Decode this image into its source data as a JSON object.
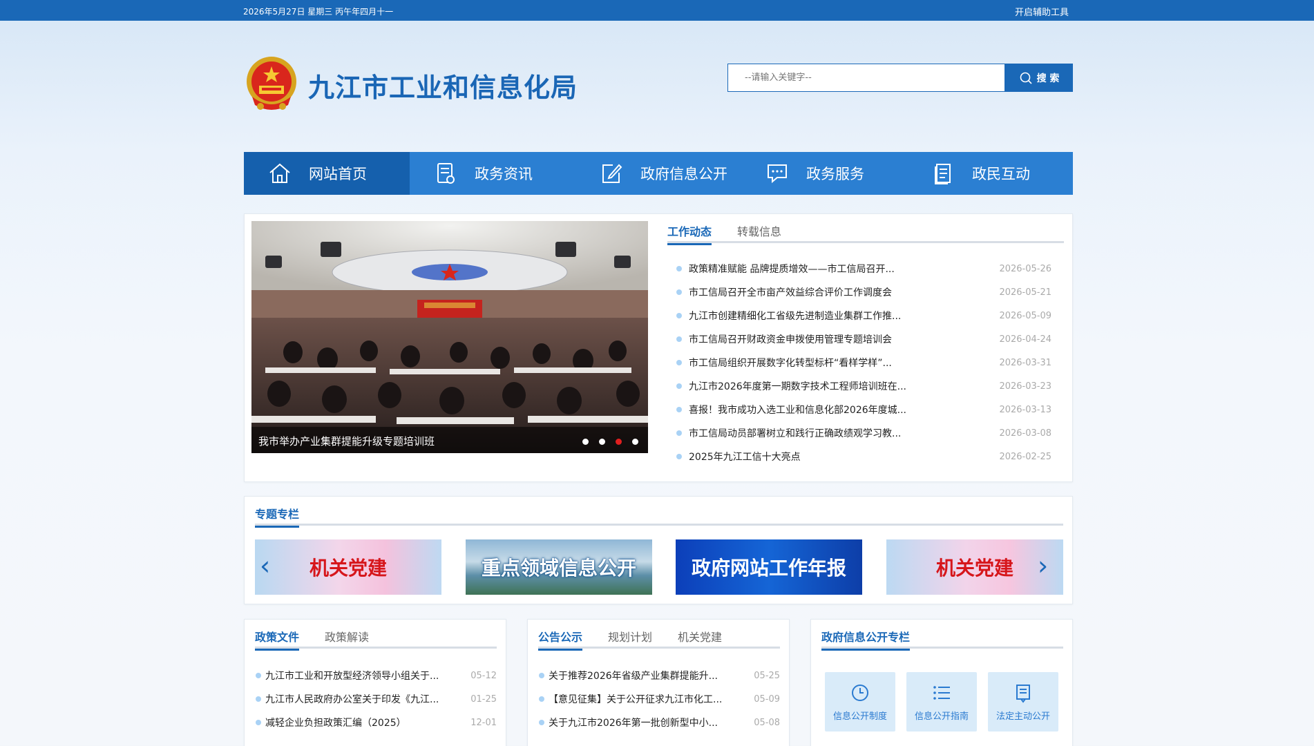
{
  "topbar": {
    "date": "2026年5月27日 星期三 丙午年四月十一",
    "accessibility": "开启辅助工具"
  },
  "header": {
    "title": "九江市工业和信息化局",
    "search_placeholder": "--请输入关键字--",
    "search_button": "搜 索"
  },
  "nav": [
    {
      "label": "网站首页",
      "icon": "home-icon"
    },
    {
      "label": "政务资讯",
      "icon": "document-icon"
    },
    {
      "label": "政府信息公开",
      "icon": "edit-icon"
    },
    {
      "label": "政务服务",
      "icon": "chat-icon"
    },
    {
      "label": "政民互动",
      "icon": "file-icon"
    }
  ],
  "slideshow": {
    "caption": "我市举办产业集群提能升级专题培训班",
    "total": 4,
    "active_index": 2
  },
  "news": {
    "tabs": [
      "工作动态",
      "转载信息"
    ],
    "items": [
      {
        "title": "政策精准赋能 品牌提质增效——市工信局召开...",
        "date": "2026-05-26"
      },
      {
        "title": "市工信局召开全市亩产效益综合评价工作调度会",
        "date": "2026-05-21"
      },
      {
        "title": "九江市创建精细化工省级先进制造业集群工作推...",
        "date": "2026-05-09"
      },
      {
        "title": "市工信局召开财政资金申拨使用管理专题培训会",
        "date": "2026-04-24"
      },
      {
        "title": "市工信局组织开展数字化转型标杆“看样学样”...",
        "date": "2026-03-31"
      },
      {
        "title": "九江市2026年度第一期数字技术工程师培训班在...",
        "date": "2026-03-23"
      },
      {
        "title": "喜报！我市成功入选工业和信息化部2026年度城...",
        "date": "2026-03-13"
      },
      {
        "title": "市工信局动员部署树立和践行正确政绩观学习教...",
        "date": "2026-03-08"
      },
      {
        "title": "2025年九江工信十大亮点",
        "date": "2026-02-25"
      }
    ]
  },
  "topics": {
    "title": "专题专栏",
    "banners": [
      "机关党建",
      "重点领域信息公开",
      "政府网站工作年报",
      "机关党建"
    ]
  },
  "policy": {
    "tabs": [
      "政策文件",
      "政策解读"
    ],
    "items": [
      {
        "title": "九江市工业和开放型经济领导小组关于...",
        "date": "05-12"
      },
      {
        "title": "九江市人民政府办公室关于印发《九江...",
        "date": "01-25"
      },
      {
        "title": "减轻企业负担政策汇编（2025）",
        "date": "12-01"
      }
    ]
  },
  "notice": {
    "tabs": [
      "公告公示",
      "规划计划",
      "机关党建"
    ],
    "items": [
      {
        "title": "关于推荐2026年省级产业集群提能升...",
        "date": "05-25"
      },
      {
        "title": "【意见征集】关于公开征求九江市化工...",
        "date": "05-09"
      },
      {
        "title": "关于九江市2026年第一批创新型中小...",
        "date": "05-08"
      }
    ]
  },
  "info_open": {
    "title": "政府信息公开专栏",
    "buttons": [
      {
        "label": "信息公开制度",
        "icon": "clock-icon"
      },
      {
        "label": "信息公开指南",
        "icon": "list-icon"
      },
      {
        "label": "法定主动公开",
        "icon": "publish-icon"
      }
    ]
  },
  "colors": {
    "primary": "#1a68b7",
    "nav": "#2b7fd2",
    "nav_active": "#1560ad",
    "accent_red": "#e11f1f"
  }
}
